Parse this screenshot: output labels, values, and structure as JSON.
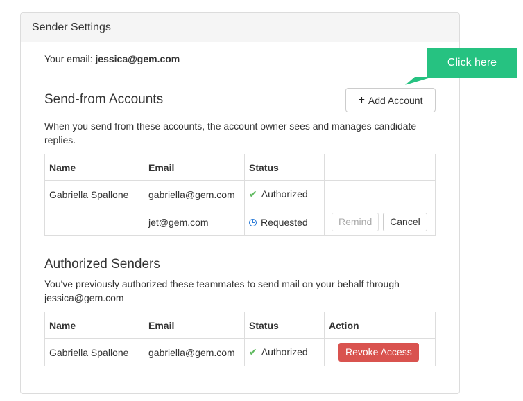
{
  "panel": {
    "title": "Sender Settings",
    "your_email_label": "Your email:",
    "your_email": "jessica@gem.com"
  },
  "send_from": {
    "title": "Send-from Accounts",
    "add_button_label": "Add Account",
    "description": "When you send from these accounts, the account owner sees and manages candidate replies.",
    "columns": [
      "Name",
      "Email",
      "Status",
      ""
    ],
    "rows": [
      {
        "name": "Gabriella Spallone",
        "email": "gabriella@gem.com",
        "status": "Authorized"
      },
      {
        "name": "",
        "email": "jet@gem.com",
        "status": "Requested",
        "remind_label": "Remind",
        "cancel_label": "Cancel"
      }
    ]
  },
  "authorized": {
    "title": "Authorized Senders",
    "description": "You've previously authorized these teammates to send mail on your behalf through jessica@gem.com",
    "columns": [
      "Name",
      "Email",
      "Status",
      "Action"
    ],
    "rows": [
      {
        "name": "Gabriella Spallone",
        "email": "gabriella@gem.com",
        "status": "Authorized",
        "action_label": "Revoke Access"
      }
    ]
  },
  "callout": {
    "label": "Click here"
  },
  "colors": {
    "callout": "#26c281",
    "authorized": "#5cb85c",
    "requested": "#2f7ed8",
    "revoke": "#d9534f"
  },
  "icons": {
    "add": "plus-icon",
    "authorized": "check-icon",
    "requested": "clock-icon"
  }
}
